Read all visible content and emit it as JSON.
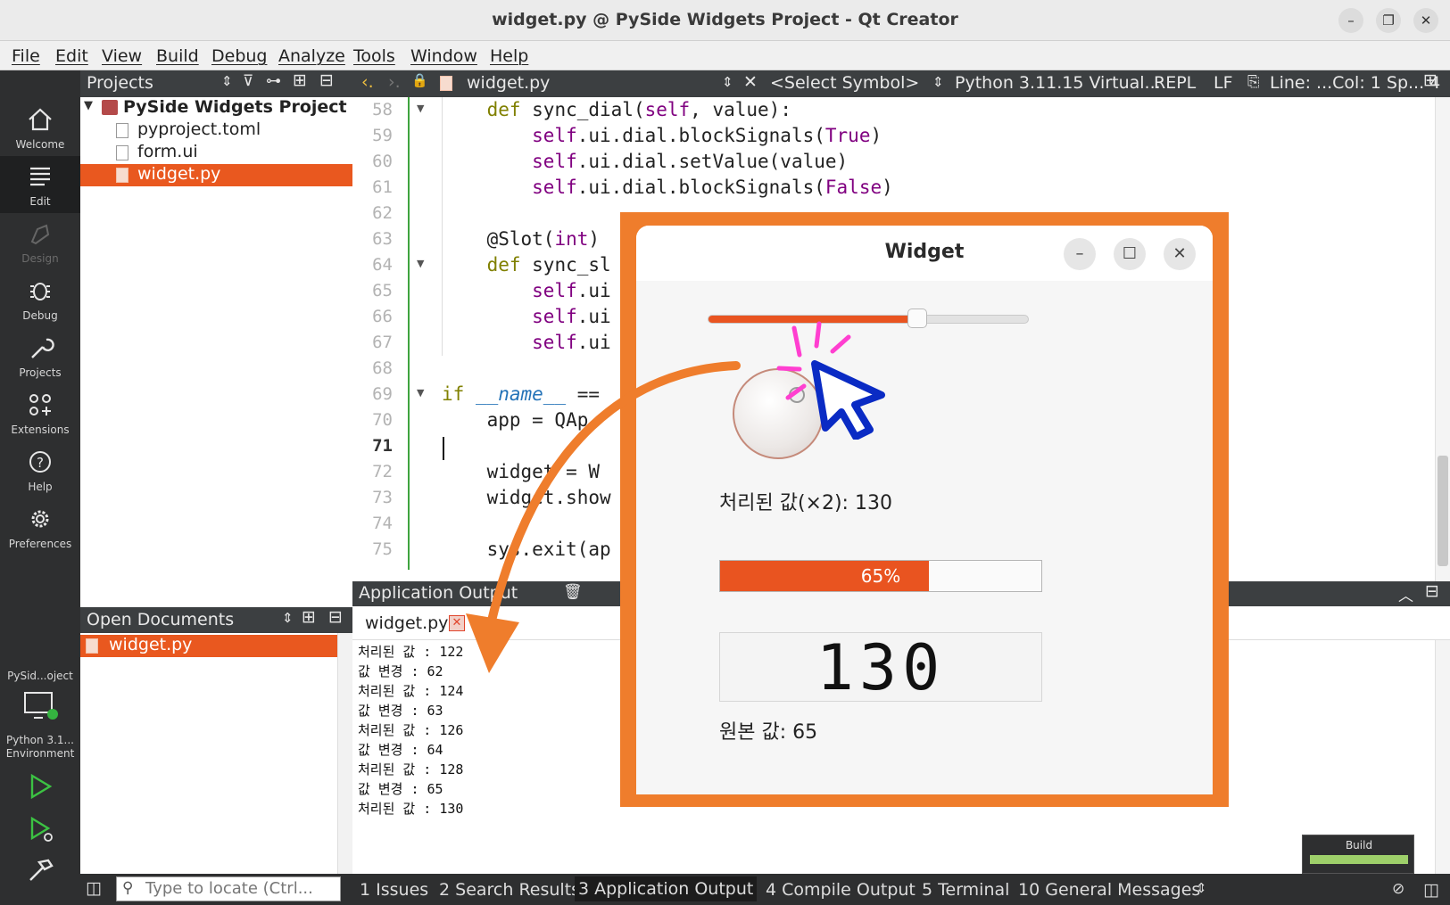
{
  "window": {
    "title": "widget.py @ PySide Widgets Project - Qt Creator"
  },
  "menu": [
    "File",
    "Edit",
    "View",
    "Build",
    "Debug",
    "Analyze",
    "Tools",
    "Window",
    "Help"
  ],
  "modes": [
    {
      "label": "Welcome",
      "icon": "home-icon"
    },
    {
      "label": "Edit",
      "icon": "edit-icon"
    },
    {
      "label": "Design",
      "icon": "design-icon"
    },
    {
      "label": "Debug",
      "icon": "bug-icon"
    },
    {
      "label": "Projects",
      "icon": "wrench-icon"
    },
    {
      "label": "Extensions",
      "icon": "extensions-icon"
    },
    {
      "label": "Help",
      "icon": "help-icon"
    },
    {
      "label": "Preferences",
      "icon": "gear-icon"
    }
  ],
  "kit": {
    "project": "PySid...oject",
    "env_line1": "Python 3.1...",
    "env_line2": "Environment"
  },
  "projects": {
    "header": "Projects",
    "root": "PySide Widgets Project",
    "files": [
      "pyproject.toml",
      "form.ui",
      "widget.py"
    ],
    "selected": "widget.py"
  },
  "open_documents": {
    "header": "Open Documents",
    "items": [
      "widget.py"
    ]
  },
  "editor": {
    "file_tab": "widget.py",
    "symbol": "<Select Symbol>",
    "interpreter": "Python 3.11.15 Virtual...",
    "repl": "REPL",
    "line_ending": "LF",
    "position": "Line: ...Col: 1 Sp... 4",
    "lines": [
      {
        "n": "58",
        "code": "    def sync_dial(self, value):"
      },
      {
        "n": "59",
        "code": "        self.ui.dial.blockSignals(True)"
      },
      {
        "n": "60",
        "code": "        self.ui.dial.setValue(value)"
      },
      {
        "n": "61",
        "code": "        self.ui.dial.blockSignals(False)"
      },
      {
        "n": "62",
        "code": ""
      },
      {
        "n": "63",
        "code": "    @Slot(int)"
      },
      {
        "n": "64",
        "code": "    def sync_sl"
      },
      {
        "n": "65",
        "code": "        self.ui"
      },
      {
        "n": "66",
        "code": "        self.ui"
      },
      {
        "n": "67",
        "code": "        self.ui"
      },
      {
        "n": "68",
        "code": ""
      },
      {
        "n": "69",
        "code": "if __name__ =="
      },
      {
        "n": "70",
        "code": "    app = QAp"
      },
      {
        "n": "71",
        "code": ""
      },
      {
        "n": "72",
        "code": "    widget = W"
      },
      {
        "n": "73",
        "code": "    widget.show"
      },
      {
        "n": "74",
        "code": ""
      },
      {
        "n": "75",
        "code": "    sys.exit(ap"
      }
    ],
    "current_line": "71"
  },
  "output": {
    "header": "Application Output",
    "tab": "widget.py",
    "lines": [
      "처리된 값 : 122",
      "값 변경 : 62",
      "처리된 값 : 124",
      "값 변경 : 63",
      "처리된 값 : 126",
      "값 변경 : 64",
      "처리된 값 : 128",
      "값 변경 : 65",
      "처리된 값 : 130"
    ]
  },
  "statusbar": {
    "locator_placeholder": "Type to locate (Ctrl...",
    "panes": [
      "1  Issues",
      "2  Search Results",
      "3  Application Output",
      "4  Compile Output",
      "5  Terminal",
      "10 General Messages"
    ],
    "active_pane": "3  Application Output",
    "build_label": "Build"
  },
  "widget_app": {
    "title": "Widget",
    "slider_value": 65,
    "slider_max": 100,
    "processed_label": "처리된 값(×2): 130",
    "progress_percent": 65,
    "progress_text": "65%",
    "lcd_value": "130",
    "original_label": "원본 값: 65"
  },
  "colors": {
    "accent": "#e95420",
    "frame": "#ef7d2c",
    "cursor": "#0a2bc4",
    "sparkle": "#ff3fd0"
  }
}
